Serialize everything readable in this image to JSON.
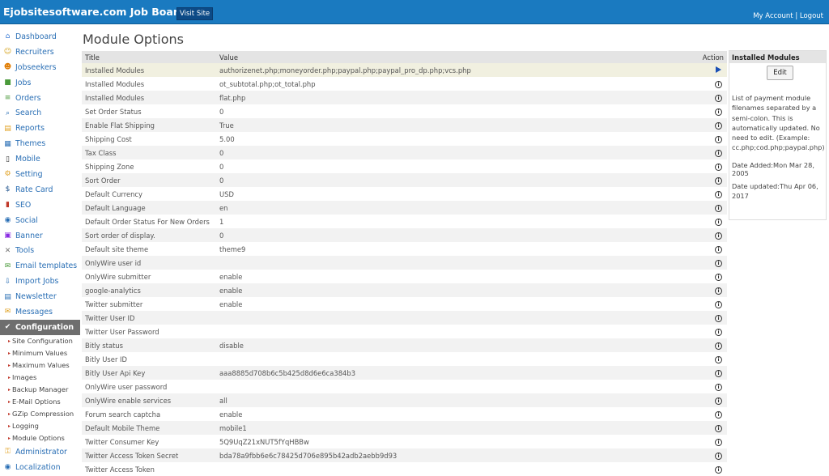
{
  "header": {
    "brand": "Ejobsitesoftware.com Job Board",
    "visit_site": "Visit Site",
    "my_account": "My Account",
    "separator": "|",
    "logout": "Logout"
  },
  "sidebar": {
    "items": [
      {
        "label": "Dashboard",
        "icon": "home-icon",
        "glyph": "⌂",
        "color": "#3a7bd5"
      },
      {
        "label": "Recruiters",
        "icon": "recruiter-icon",
        "glyph": "☺",
        "color": "#d4a017"
      },
      {
        "label": "Jobseekers",
        "icon": "jobseeker-icon",
        "glyph": "☻",
        "color": "#e07b00"
      },
      {
        "label": "Jobs",
        "icon": "jobs-icon",
        "glyph": "■",
        "color": "#4a9a3a"
      },
      {
        "label": "Orders",
        "icon": "orders-icon",
        "glyph": "≡",
        "color": "#4a9a3a"
      },
      {
        "label": "Search",
        "icon": "search-icon",
        "glyph": "⌕",
        "color": "#2a6fb5"
      },
      {
        "label": "Reports",
        "icon": "reports-icon",
        "glyph": "▤",
        "color": "#e0a020"
      },
      {
        "label": "Themes",
        "icon": "themes-icon",
        "glyph": "▦",
        "color": "#2a6fb5"
      },
      {
        "label": "Mobile",
        "icon": "mobile-icon",
        "glyph": "▯",
        "color": "#333"
      },
      {
        "label": "Setting",
        "icon": "setting-icon",
        "glyph": "⚙",
        "color": "#e0a020"
      },
      {
        "label": "Rate Card",
        "icon": "dollar-icon",
        "glyph": "$",
        "color": "#1a4f8a"
      },
      {
        "label": "SEO",
        "icon": "seo-icon",
        "glyph": "▮",
        "color": "#c0392b"
      },
      {
        "label": "Social",
        "icon": "social-icon",
        "glyph": "◉",
        "color": "#2a6fb5"
      },
      {
        "label": "Banner",
        "icon": "banner-icon",
        "glyph": "▣",
        "color": "#8a2be2"
      },
      {
        "label": "Tools",
        "icon": "tools-icon",
        "glyph": "✕",
        "color": "#777"
      },
      {
        "label": "Email templates",
        "icon": "email-icon",
        "glyph": "✉",
        "color": "#4a9a3a"
      },
      {
        "label": "Import Jobs",
        "icon": "import-icon",
        "glyph": "⇩",
        "color": "#2a6fb5"
      },
      {
        "label": "Newsletter",
        "icon": "newsletter-icon",
        "glyph": "▤",
        "color": "#2a6fb5"
      },
      {
        "label": "Messages",
        "icon": "messages-icon",
        "glyph": "✉",
        "color": "#e0a020"
      },
      {
        "label": "Configuration",
        "icon": "configuration-icon",
        "glyph": "✔",
        "color": "#ffffff",
        "active": true
      }
    ],
    "subitems": [
      "Site Configuration",
      "Minimum Values",
      "Maximum Values",
      "Images",
      "Backup Manager",
      "E-Mail Options",
      "GZip Compression",
      "Logging",
      "Module Options"
    ],
    "bottom_items": [
      {
        "label": "Administrator",
        "icon": "administrator-icon",
        "glyph": "⚿",
        "color": "#e0a020"
      },
      {
        "label": "Localization",
        "icon": "localization-icon",
        "glyph": "◉",
        "color": "#2a6fb5"
      }
    ]
  },
  "main": {
    "title": "Module Options",
    "columns": {
      "title": "Title",
      "value": "Value",
      "action": "Action"
    },
    "rows": [
      {
        "title": "Installed Modules",
        "value": "authorizenet.php;moneyorder.php;paypal.php;paypal_pro_dp.php;vcs.php",
        "selected": true
      },
      {
        "title": "Installed Modules",
        "value": "ot_subtotal.php;ot_total.php"
      },
      {
        "title": "Installed Modules",
        "value": "flat.php"
      },
      {
        "title": "Set Order Status",
        "value": "0"
      },
      {
        "title": "Enable Flat Shipping",
        "value": "True"
      },
      {
        "title": "Shipping Cost",
        "value": "5.00"
      },
      {
        "title": "Tax Class",
        "value": "0"
      },
      {
        "title": "Shipping Zone",
        "value": "0"
      },
      {
        "title": "Sort Order",
        "value": "0"
      },
      {
        "title": "Default Currency",
        "value": "USD"
      },
      {
        "title": "Default Language",
        "value": "en"
      },
      {
        "title": "Default Order Status For New Orders",
        "value": "1"
      },
      {
        "title": "Sort order of display.",
        "value": "0"
      },
      {
        "title": "Default site theme",
        "value": "theme9"
      },
      {
        "title": "OnlyWire user id",
        "value": ""
      },
      {
        "title": "OnlyWire submitter",
        "value": "enable"
      },
      {
        "title": "google-analytics",
        "value": "enable"
      },
      {
        "title": "Twitter submitter",
        "value": "enable"
      },
      {
        "title": "Twitter User ID",
        "value": ""
      },
      {
        "title": "Twitter User Password",
        "value": ""
      },
      {
        "title": "Bitly status",
        "value": "disable"
      },
      {
        "title": "Bitly User ID",
        "value": ""
      },
      {
        "title": "Bitly User Api Key",
        "value": "aaa8885d708b6c5b425d8d6e6ca384b3"
      },
      {
        "title": "OnlyWire user password",
        "value": ""
      },
      {
        "title": "OnlyWire enable services",
        "value": "all"
      },
      {
        "title": "Forum search captcha",
        "value": "enable"
      },
      {
        "title": "Default Mobile Theme",
        "value": "mobile1"
      },
      {
        "title": "Twitter Consumer Key",
        "value": "5Q9UqZ21xNUT5fYqHBBw"
      },
      {
        "title": "Twitter Access Token Secret",
        "value": "bda78a9fbb6e6c78425d706e895b42adb2aebb9d93"
      },
      {
        "title": "Twitter Access Token",
        "value": ""
      }
    ]
  },
  "panel": {
    "title": "Installed Modules",
    "edit_label": "Edit",
    "description": "List of payment module filenames separated by a semi-colon. This is automatically updated. No need to edit. (Example: cc.php;cod.php;paypal.php)",
    "date_added": "Date Added:Mon Mar 28, 2005",
    "date_updated": "Date updated:Thu Apr 06, 2017"
  }
}
